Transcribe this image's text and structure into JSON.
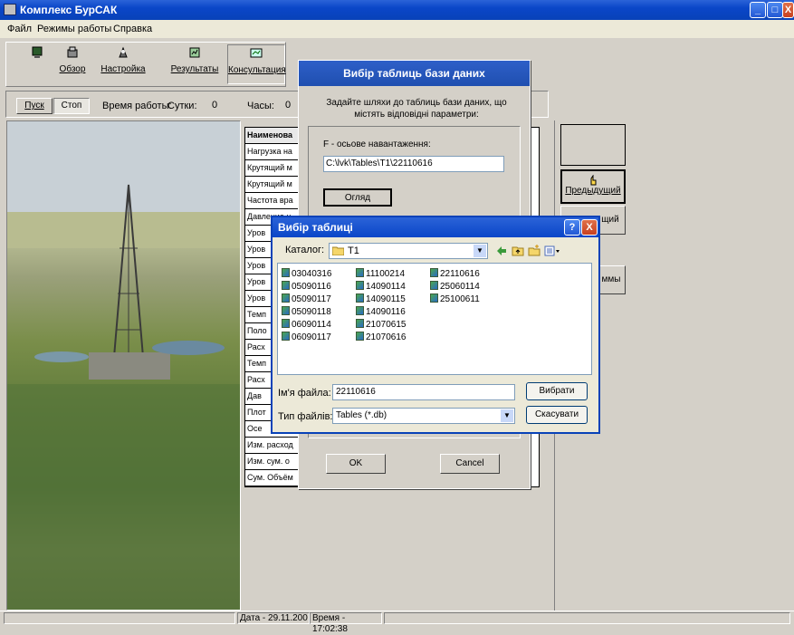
{
  "window": {
    "title": "Комплекс БурСАК",
    "min": "_",
    "max": "□",
    "close": "X"
  },
  "menu": [
    "Файл",
    "Режимы работы",
    "Справка"
  ],
  "toolbar": [
    {
      "label": ""
    },
    {
      "label": "Обзор"
    },
    {
      "label": "Настройка"
    },
    {
      "label": "Результаты"
    },
    {
      "label": "Консультация"
    }
  ],
  "controls": {
    "start": "Пуск",
    "stop": "Стоп",
    "runtime_label": "Время работы:",
    "days_label": "Сутки:",
    "days_value": "0",
    "hours_label": "Часы:",
    "hours_value": "0"
  },
  "grid": {
    "header": "Наименова",
    "rows": [
      "Нагрузка на",
      "Крутящий м",
      "Крутящий м",
      "Частота вра",
      "Давление н",
      "Уров",
      "Уров",
      "Уров",
      "Уров",
      "Уров",
      "Темп",
      "Поло",
      "Расх",
      "Темп",
      "Расх",
      "Дав",
      "Плот",
      "Осе",
      "Изм. расход",
      "Изм. сум. о",
      "Сум. Объём"
    ]
  },
  "right_panel": {
    "prev_label": "Предыдущий",
    "next_partial": "щий",
    "programs_partial": "ммы"
  },
  "dialog_tables": {
    "title": "Вибір таблиць бази даних",
    "description": "Задайте шляхи до таблиць бази даних, що містять відповідні параметри:",
    "param_label": "F - осьове навантаження:",
    "param_path": "C:\\lvk\\Tables\\T1\\22110616",
    "browse": "Огляд",
    "ok": "OK",
    "cancel": "Cancel"
  },
  "dialog_open": {
    "title": "Вибір таблиці",
    "help": "?",
    "close": "X",
    "catalog_label": "Каталог:",
    "catalog_value": "T1",
    "files_col1": [
      "03040316",
      "05090116",
      "05090117",
      "05090118",
      "06090114",
      "06090117"
    ],
    "files_col2": [
      "11100214",
      "14090114",
      "14090115",
      "14090116",
      "21070615",
      "21070616"
    ],
    "files_col3": [
      "22110616",
      "25060114",
      "25100611"
    ],
    "filename_label": "Ім'я файла:",
    "filename_value": "22110616",
    "filetype_label": "Тип файлів:",
    "filetype_value": "Tables (*.db)",
    "select": "Вибрати",
    "cancel": "Скасувати"
  },
  "status": {
    "date": "Дата - 29.11.200",
    "time": "Время - 17:02:38"
  }
}
